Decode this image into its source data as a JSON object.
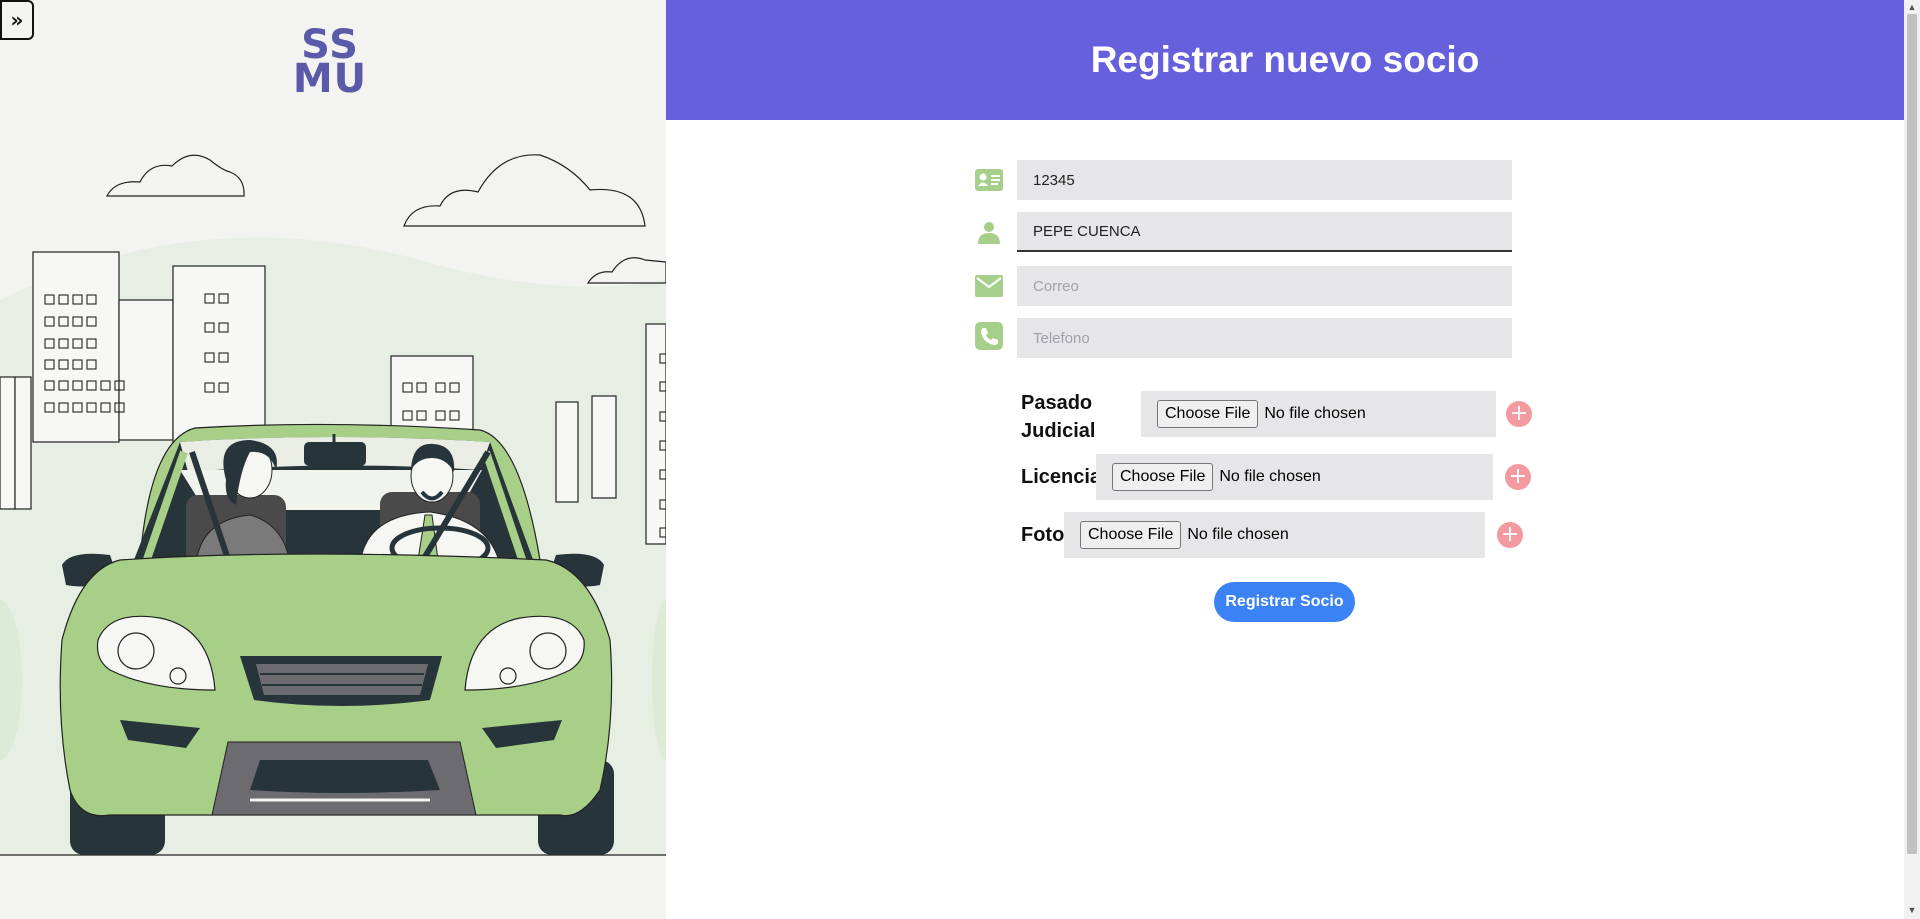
{
  "sidebar": {
    "toggle_label": "»",
    "logo_line1": "SS",
    "logo_line2": "MU"
  },
  "header": {
    "title": "Registrar nuevo socio"
  },
  "form": {
    "id_field": {
      "value": "12345",
      "icon": "id-card-icon"
    },
    "name_field": {
      "value": "PEPE CUENCA",
      "icon": "person-icon"
    },
    "email_field": {
      "placeholder": "Correo",
      "icon": "envelope-icon"
    },
    "phone_field": {
      "placeholder": "Telefono",
      "icon": "phone-icon"
    }
  },
  "uploads": [
    {
      "label_line1": "Pasado",
      "label_line2": "Judicial",
      "button": "Choose File",
      "status": "No file chosen"
    },
    {
      "label": "Licencia",
      "button": "Choose File",
      "status": "No file chosen"
    },
    {
      "label": "Foto",
      "button": "Choose File",
      "status": "No file chosen"
    }
  ],
  "add_button_symbol": "+",
  "submit_label": "Registrar Socio",
  "colors": {
    "header_bg": "#6660dc",
    "icon_green": "#a6cf8a",
    "add_button": "#f29aa0",
    "submit_bg": "#3b82f6",
    "car_green": "#a8cf88"
  }
}
